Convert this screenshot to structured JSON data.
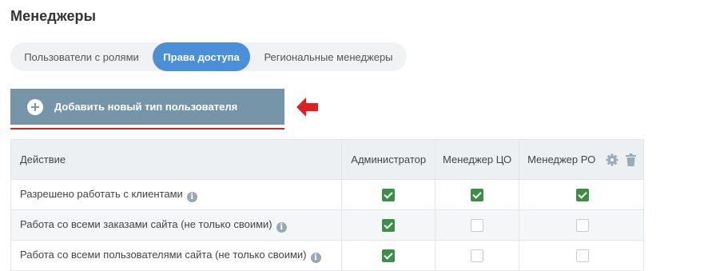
{
  "page": {
    "title": "Менеджеры"
  },
  "tabs": [
    {
      "label": "Пользователи с ролями",
      "active": false
    },
    {
      "label": "Права доступа",
      "active": true
    },
    {
      "label": "Региональные менеджеры",
      "active": false
    }
  ],
  "add_button": {
    "label": "Добавить новый тип пользователя",
    "icon": "plus-circle-icon"
  },
  "table": {
    "headers": {
      "action": "Действие",
      "admin": "Администратор",
      "manager_co": "Менеджер ЦО",
      "manager_ro": "Менеджер РО"
    },
    "rows": [
      {
        "label": "Разрешено работать с клиентами",
        "admin": true,
        "manager_co": true,
        "manager_ro": true
      },
      {
        "label": "Работа со всеми заказами сайта (не только своими)",
        "admin": true,
        "manager_co": false,
        "manager_ro": false
      },
      {
        "label": "Работа со всеми пользователями сайта (не только своими)",
        "admin": true,
        "manager_co": false,
        "manager_ro": false
      }
    ]
  },
  "info_icon_glyph": "i",
  "colors": {
    "accent": "#4b8fd8",
    "button": "#7795a9",
    "checkbox_checked": "#3e8e4a",
    "arrow": "#e02020",
    "underline": "#d4252a"
  }
}
